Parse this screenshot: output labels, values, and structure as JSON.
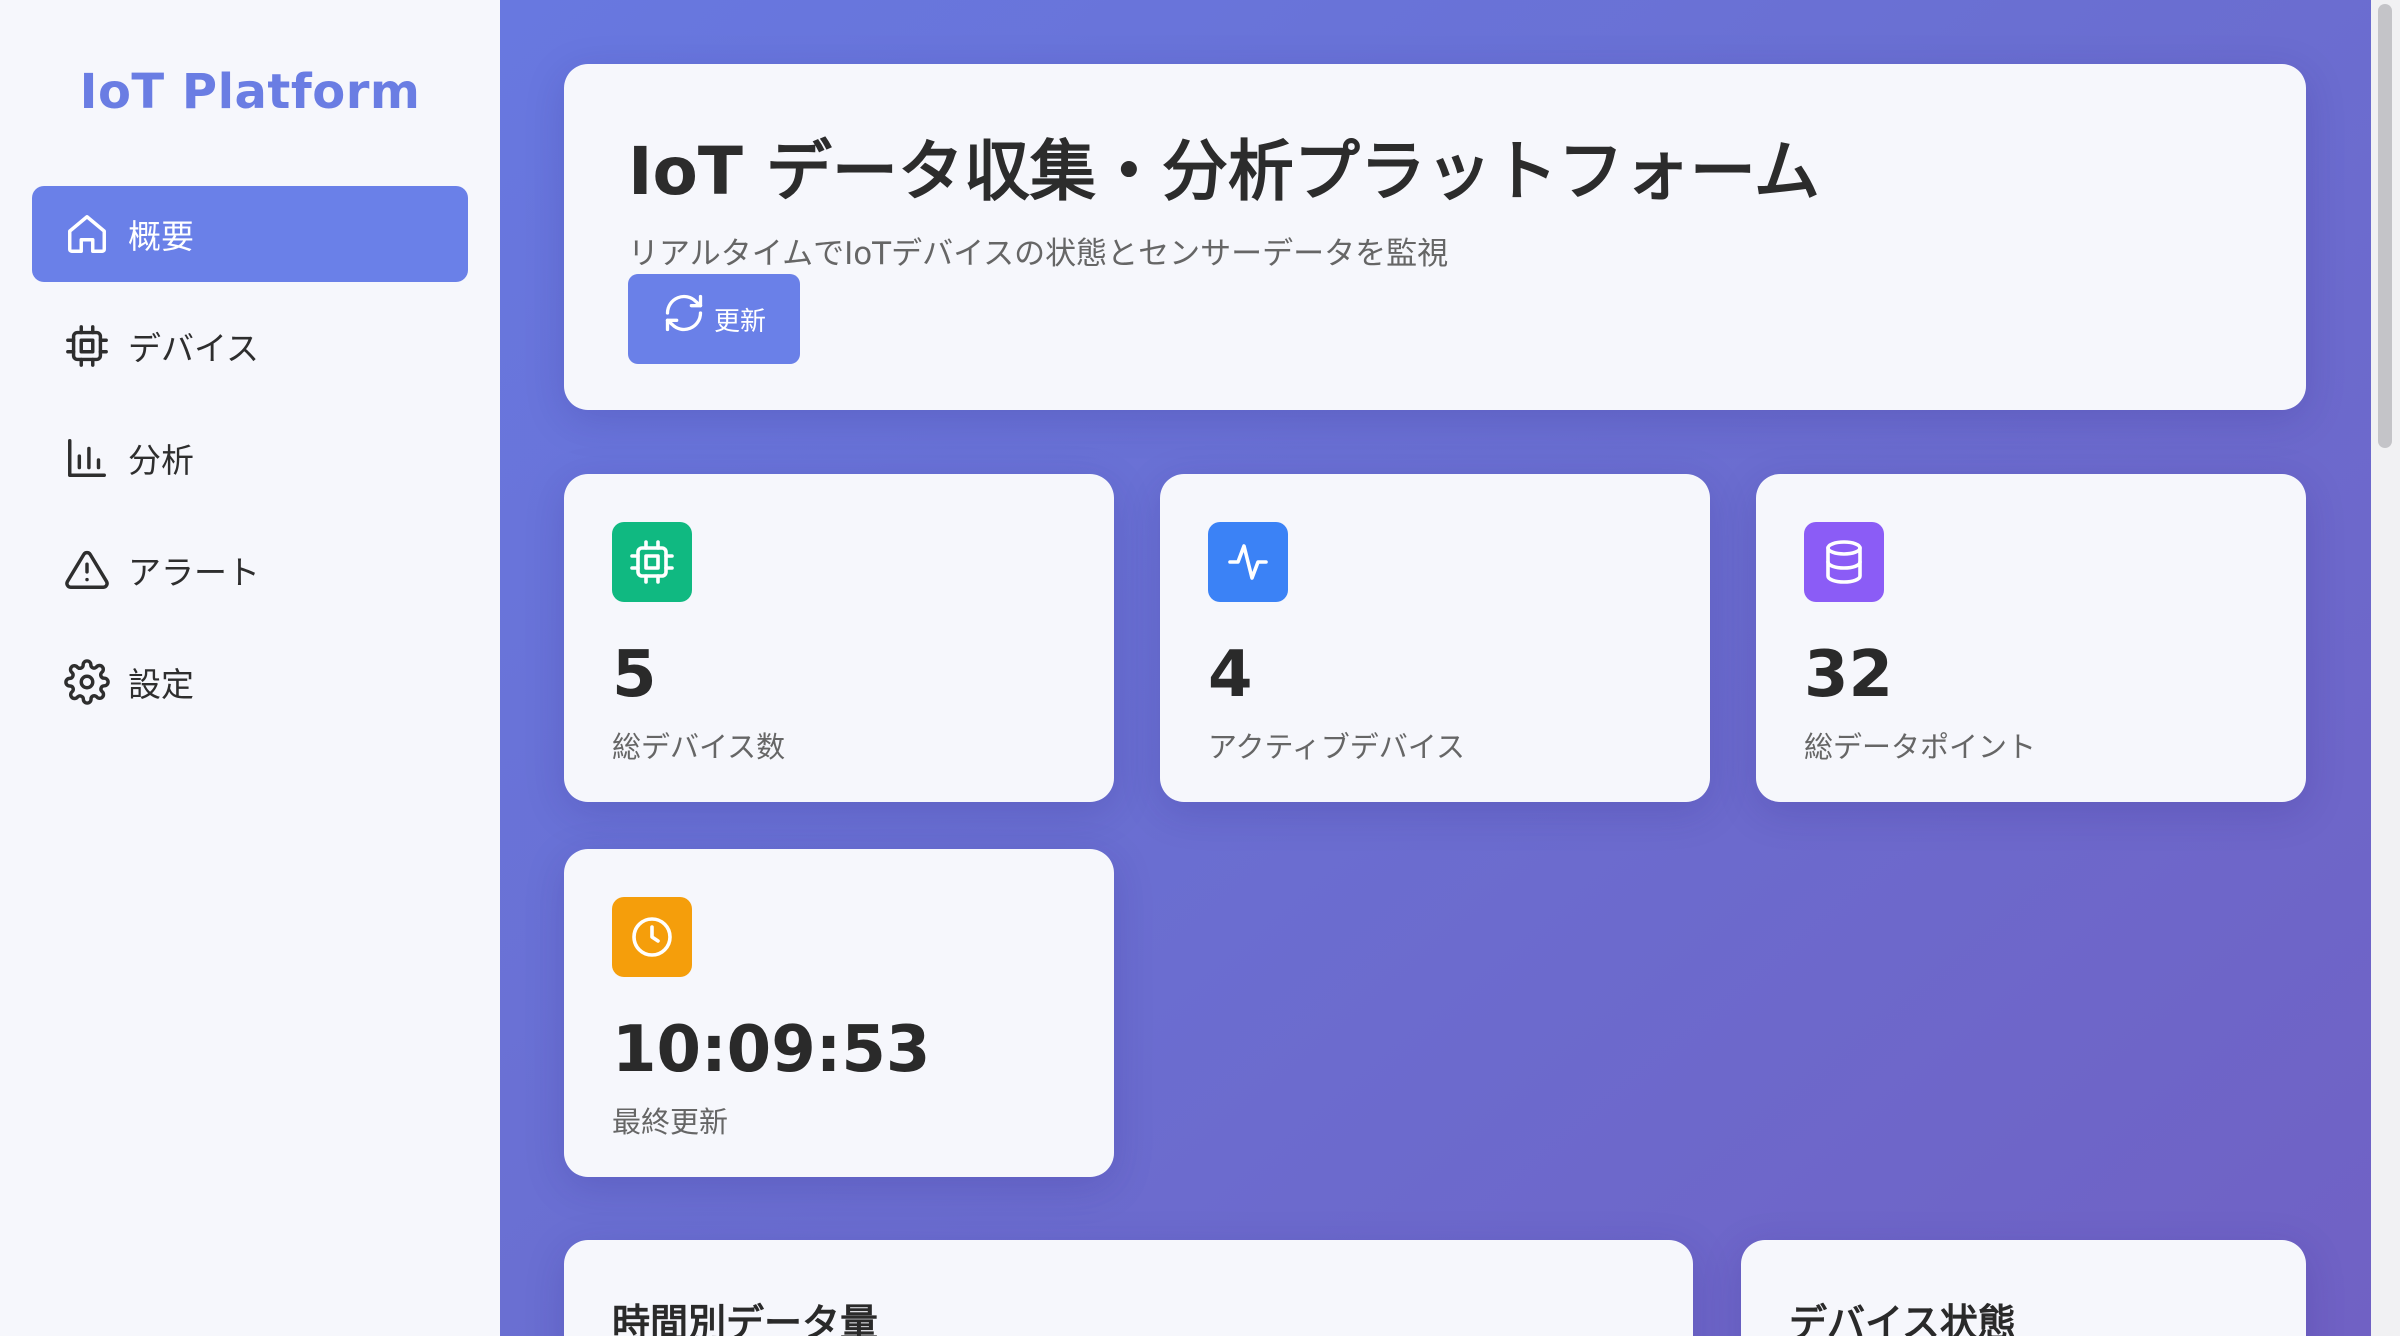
{
  "sidebar": {
    "brand": "IoT Platform",
    "items": [
      {
        "label": "概要",
        "icon": "home-icon",
        "active": true
      },
      {
        "label": "デバイス",
        "icon": "chip-icon",
        "active": false
      },
      {
        "label": "分析",
        "icon": "bar-chart-icon",
        "active": false
      },
      {
        "label": "アラート",
        "icon": "alert-triangle-icon",
        "active": false
      },
      {
        "label": "設定",
        "icon": "gear-icon",
        "active": false
      }
    ]
  },
  "header": {
    "title": "IoT データ収集・分析プラットフォーム",
    "subtitle": "リアルタイムでIoTデバイスの状態とセンサーデータを監視",
    "refresh_label": "更新",
    "refresh_icon": "refresh-icon"
  },
  "stats": [
    {
      "value": "5",
      "label": "総デバイス数",
      "icon": "chip-icon",
      "color": "#10b981"
    },
    {
      "value": "4",
      "label": "アクティブデバイス",
      "icon": "activity-icon",
      "color": "#3b82f6"
    },
    {
      "value": "32",
      "label": "総データポイント",
      "icon": "database-icon",
      "color": "#8b5cf6"
    },
    {
      "value": "10:09:53",
      "label": "最終更新",
      "icon": "clock-icon",
      "color": "#f59e0b"
    }
  ],
  "panels": {
    "hourly_title": "時間別データ量",
    "device_status_title": "デバイス状態"
  },
  "colors": {
    "accent": "#6a80e8",
    "brand": "#6a7de3"
  }
}
